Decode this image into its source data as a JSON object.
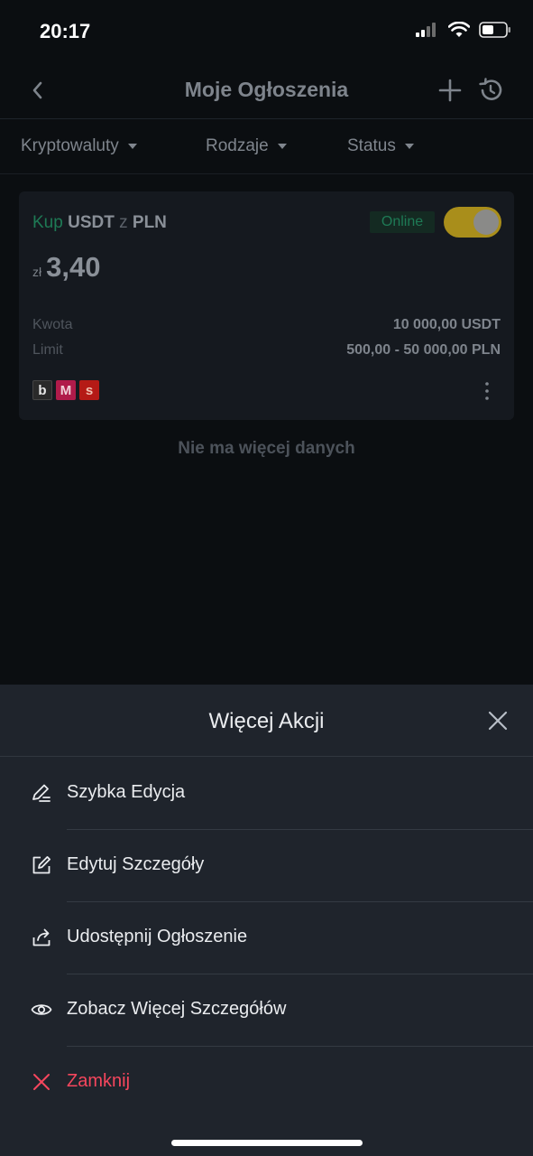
{
  "status_bar": {
    "time": "20:17"
  },
  "nav": {
    "title": "Moje Ogłoszenia"
  },
  "filters": [
    {
      "label": "Kryptowaluty"
    },
    {
      "label": "Rodzaje"
    },
    {
      "label": "Status"
    }
  ],
  "ad": {
    "side": "Kup",
    "asset": "USDT",
    "connector": "z",
    "fiat": "PLN",
    "status": "Online",
    "currency_symbol": "zł",
    "price": "3,40",
    "amount_label": "Kwota",
    "amount_value": "10 000,00 USDT",
    "limit_label": "Limit",
    "limit_value": "500,00 - 50 000,00 PLN",
    "payment_methods": [
      "b",
      "M",
      "s"
    ],
    "toggle_on": true
  },
  "list_end_text": "Nie ma więcej danych",
  "sheet": {
    "title": "Więcej Akcji",
    "actions": [
      {
        "label": "Szybka Edycja",
        "icon": "quick-edit-icon"
      },
      {
        "label": "Edytuj Szczegóły",
        "icon": "edit-details-icon"
      },
      {
        "label": "Udostępnij Ogłoszenie",
        "icon": "share-icon"
      },
      {
        "label": "Zobacz Więcej Szczegółów",
        "icon": "eye-icon"
      },
      {
        "label": "Zamknij",
        "icon": "close-icon"
      }
    ]
  },
  "colors": {
    "background": "#0b0e11",
    "sheet": "#1f242c",
    "buy_green": "#1e7a55",
    "toggle_yellow": "#a98e1b",
    "danger_red": "#f6465d"
  }
}
